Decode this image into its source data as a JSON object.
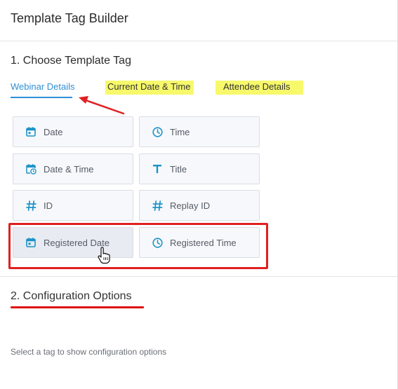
{
  "header": {
    "title": "Template Tag Builder"
  },
  "section1": {
    "title": "1. Choose Template Tag",
    "tabs": [
      {
        "label": "Webinar Details",
        "active": true
      },
      {
        "label": "Current Date & Time",
        "highlighted": true
      },
      {
        "label": "Attendee Details",
        "highlighted": true
      }
    ],
    "tags": [
      {
        "label": "Date",
        "icon": "calendar-icon"
      },
      {
        "label": "Time",
        "icon": "clock-icon"
      },
      {
        "label": "Date & Time",
        "icon": "calendar-clock-icon"
      },
      {
        "label": "Title",
        "icon": "text-t-icon"
      },
      {
        "label": "ID",
        "icon": "hash-icon"
      },
      {
        "label": "Replay ID",
        "icon": "hash-icon"
      },
      {
        "label": "Registered Date",
        "icon": "calendar-icon",
        "hovered": true
      },
      {
        "label": "Registered Time",
        "icon": "clock-icon"
      }
    ]
  },
  "section2": {
    "title": "2. Configuration Options",
    "hint": "Select a tag to show configuration options"
  },
  "colors": {
    "accent": "#2f8fd6",
    "icon": "#1a93c8",
    "highlight_yellow": "#f7f96b",
    "annotation_red": "#e02020"
  }
}
